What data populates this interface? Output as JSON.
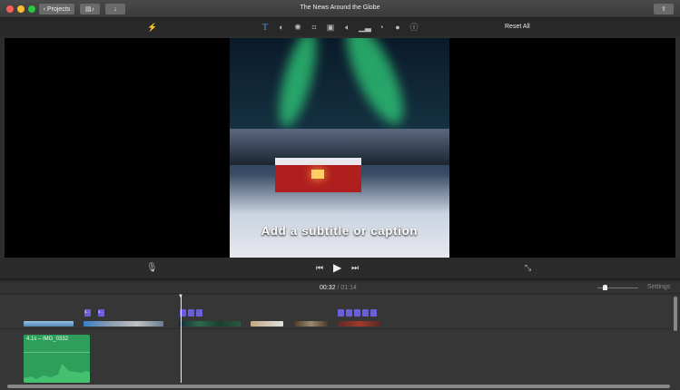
{
  "window": {
    "title": "The News Around the Globe",
    "projects_label": "Projects"
  },
  "toolbar": {
    "reset_label": "Reset All",
    "tools": [
      "magic-wand",
      "title",
      "color-balance",
      "color-correction",
      "crop",
      "stabilization",
      "volume",
      "noise-reduction",
      "speed",
      "clip-filter",
      "info"
    ],
    "active_tool": "title"
  },
  "viewer": {
    "caption": "Add a subtitle or caption"
  },
  "timeline": {
    "current_time": "00:32",
    "separator": "/",
    "total_time": "01:14",
    "settings_label": "Settings",
    "audio_clip_label": "4.1s – IMG_0332",
    "title_tags": [
      "4...",
      "4..."
    ]
  },
  "colors": {
    "accent": "#4a90d9",
    "audio_clip": "#2e9e5a",
    "title_tag": "#6a5fd9"
  }
}
